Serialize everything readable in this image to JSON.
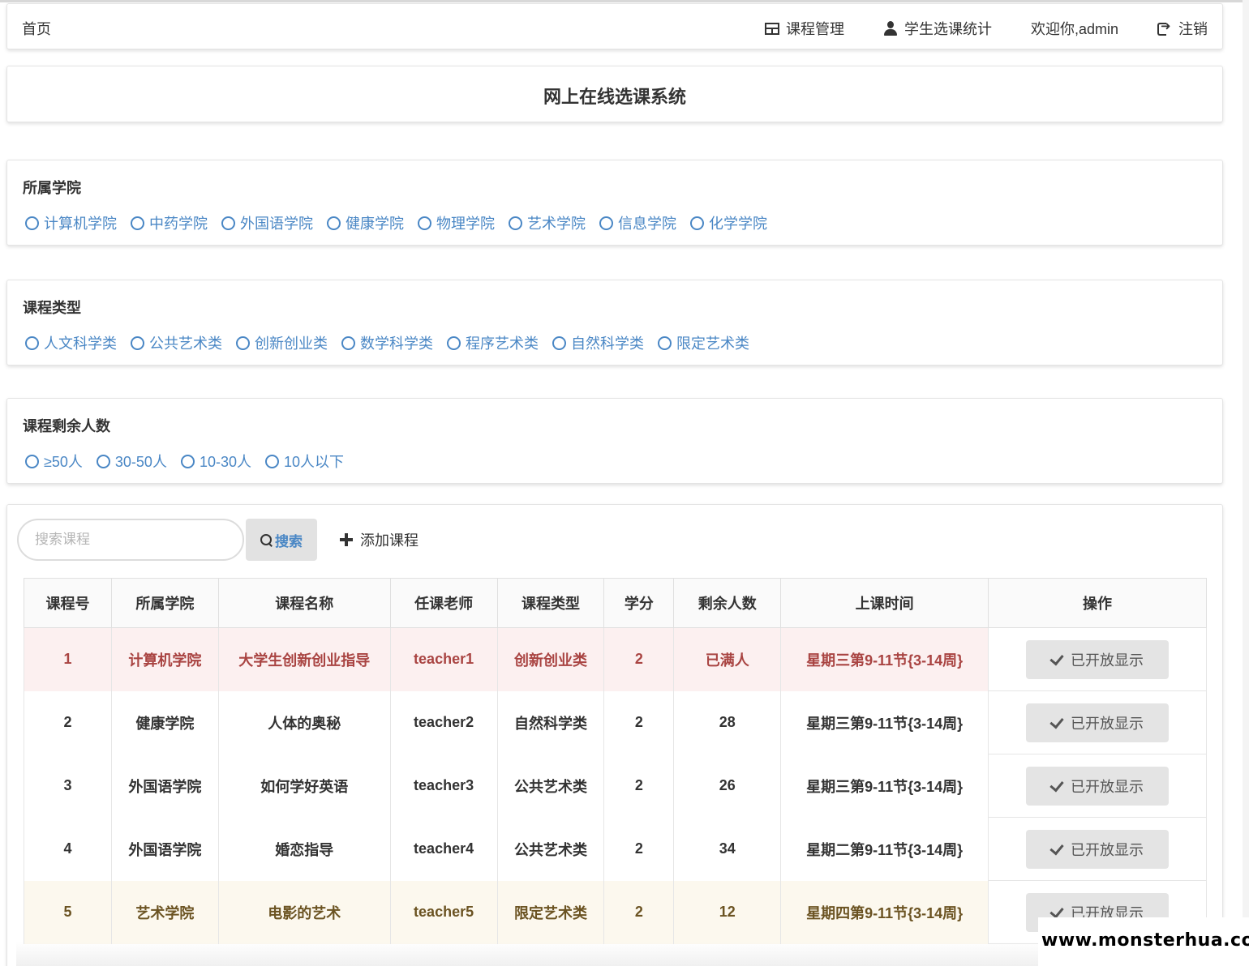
{
  "nav": {
    "home": "首页",
    "course_manage": "课程管理",
    "student_stats": "学生选课统计",
    "welcome": "欢迎你,admin",
    "logout": "注销"
  },
  "title": "网上在线选课系统",
  "filters": {
    "college": {
      "label": "所属学院",
      "options": [
        "计算机学院",
        "中药学院",
        "外国语学院",
        "健康学院",
        "物理学院",
        "艺术学院",
        "信息学院",
        "化学学院"
      ]
    },
    "type": {
      "label": "课程类型",
      "options": [
        "人文科学类",
        "公共艺术类",
        "创新创业类",
        "数学科学类",
        "程序艺术类",
        "自然科学类",
        "限定艺术类"
      ]
    },
    "remaining": {
      "label": "课程剩余人数",
      "options": [
        "≥50人",
        "30-50人",
        "10-30人",
        "10人以下"
      ]
    }
  },
  "toolbar": {
    "search_placeholder": "搜索课程",
    "search_label": "搜索",
    "add_label": "添加课程"
  },
  "table": {
    "headers": [
      "课程号",
      "所属学院",
      "课程名称",
      "任课老师",
      "课程类型",
      "学分",
      "剩余人数",
      "上课时间",
      "操作"
    ],
    "rows": [
      {
        "id": "1",
        "college": "计算机学院",
        "name": "大学生创新创业指导",
        "teacher": "teacher1",
        "type": "创新创业类",
        "credit": "2",
        "remaining": "已满人",
        "time": "星期三第9-11节{3-14周}",
        "action": "已开放显示",
        "status": "danger"
      },
      {
        "id": "2",
        "college": "健康学院",
        "name": "人体的奥秘",
        "teacher": "teacher2",
        "type": "自然科学类",
        "credit": "2",
        "remaining": "28",
        "time": "星期三第9-11节{3-14周}",
        "action": "已开放显示",
        "status": "normal"
      },
      {
        "id": "3",
        "college": "外国语学院",
        "name": "如何学好英语",
        "teacher": "teacher3",
        "type": "公共艺术类",
        "credit": "2",
        "remaining": "26",
        "time": "星期三第9-11节{3-14周}",
        "action": "已开放显示",
        "status": "normal"
      },
      {
        "id": "4",
        "college": "外国语学院",
        "name": "婚恋指导",
        "teacher": "teacher4",
        "type": "公共艺术类",
        "credit": "2",
        "remaining": "34",
        "time": "星期二第9-11节{3-14周}",
        "action": "已开放显示",
        "status": "normal"
      },
      {
        "id": "5",
        "college": "艺术学院",
        "name": "电影的艺术",
        "teacher": "teacher5",
        "type": "限定艺术类",
        "credit": "2",
        "remaining": "12",
        "time": "星期四第9-11节{3-14周}",
        "action": "已开放显示",
        "status": "warning"
      }
    ]
  },
  "watermark": "www.monsterhua.com",
  "colors": {
    "link": "#4a87c5",
    "danger_text": "#a94442",
    "danger_bg": "#fcf0f0",
    "warning_text": "#6b5322",
    "warning_bg": "#fcf8ee"
  }
}
